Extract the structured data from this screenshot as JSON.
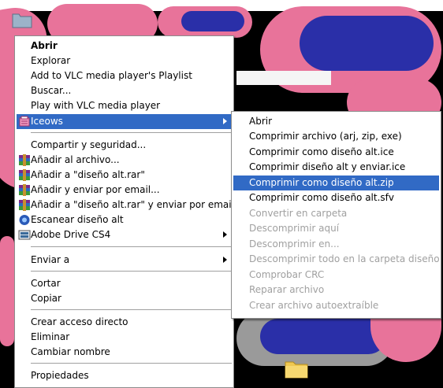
{
  "main_menu": {
    "items": [
      {
        "label": "Abrir"
      },
      {
        "label": "Explorar"
      },
      {
        "label": "Add to VLC media player's Playlist"
      },
      {
        "label": "Buscar..."
      },
      {
        "label": "Play with VLC media player"
      },
      {
        "label": "Iceows",
        "icon": "iceows-icon",
        "highlighted": true,
        "submenu": true
      },
      {
        "label": "Compartir y seguridad..."
      },
      {
        "label": "Añadir al archivo...",
        "icon": "winrar-icon"
      },
      {
        "label": "Añadir a \"diseño alt.rar\"",
        "icon": "winrar-icon"
      },
      {
        "label": "Añadir y enviar por email...",
        "icon": "winrar-icon"
      },
      {
        "label": "Añadir a \"diseño alt.rar\" y enviar por email",
        "icon": "winrar-icon"
      },
      {
        "label": "Escanear diseño alt",
        "icon": "antivirus-scan-icon"
      },
      {
        "label": "Adobe Drive CS4",
        "icon": "adobe-drive-icon",
        "submenu": true
      },
      {
        "label": "Enviar a",
        "submenu": true
      },
      {
        "label": "Cortar"
      },
      {
        "label": "Copiar"
      },
      {
        "label": "Crear acceso directo"
      },
      {
        "label": "Eliminar"
      },
      {
        "label": "Cambiar nombre"
      },
      {
        "label": "Propiedades"
      }
    ]
  },
  "sub_menu": {
    "items": [
      {
        "label": "Abrir"
      },
      {
        "label": "Comprimir archivo (arj, zip, exe)"
      },
      {
        "label": "Comprimir como diseño alt.ice"
      },
      {
        "label": "Comprimir diseño alt y enviar.ice"
      },
      {
        "label": "Comprimir como diseño alt.zip",
        "highlighted": true
      },
      {
        "label": "Comprimir como  diseño alt.sfv"
      },
      {
        "label": "Convertir en carpeta",
        "disabled": true
      },
      {
        "label": "Descomprimir aquí",
        "disabled": true
      },
      {
        "label": "Descomprimir en...",
        "disabled": true
      },
      {
        "label": "Descomprimir todo en la carpeta diseño alt",
        "disabled": true
      },
      {
        "label": "Comprobar CRC",
        "disabled": true
      },
      {
        "label": "Reparar archivo",
        "disabled": true
      },
      {
        "label": "Crear archivo autoextraíble",
        "disabled": true
      }
    ]
  },
  "colors": {
    "highlight": "#316ac5",
    "disabled_text": "#a0a0a0",
    "desktop_pink": "#e8739a",
    "desktop_blue": "#2a2fa8"
  }
}
